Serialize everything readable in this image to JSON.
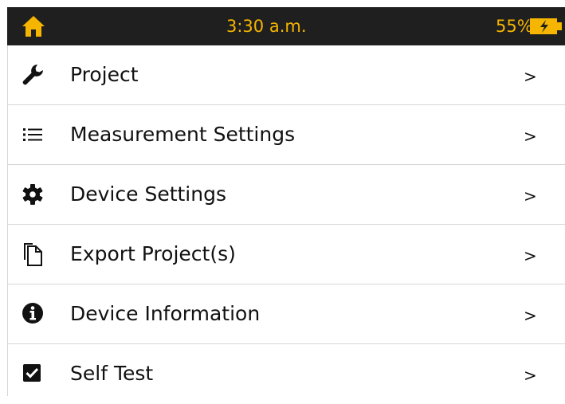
{
  "status_bar": {
    "time": "3:30 a.m.",
    "battery_percent": "55%",
    "home_icon": "home-icon",
    "battery_icon": "battery-icon",
    "accent_color": "#f6b500",
    "background_color": "#1f1f1f"
  },
  "menu": {
    "items": [
      {
        "label": "Project",
        "icon": "wrench-icon",
        "chevron": ">"
      },
      {
        "label": "Measurement Settings",
        "icon": "list-icon",
        "chevron": ">"
      },
      {
        "label": "Device Settings",
        "icon": "gear-icon",
        "chevron": ">"
      },
      {
        "label": "Export Project(s)",
        "icon": "copy-file-icon",
        "chevron": ">"
      },
      {
        "label": "Device Information",
        "icon": "info-icon",
        "chevron": ">"
      },
      {
        "label": "Self Test",
        "icon": "checkbox-icon",
        "chevron": ">"
      }
    ]
  }
}
